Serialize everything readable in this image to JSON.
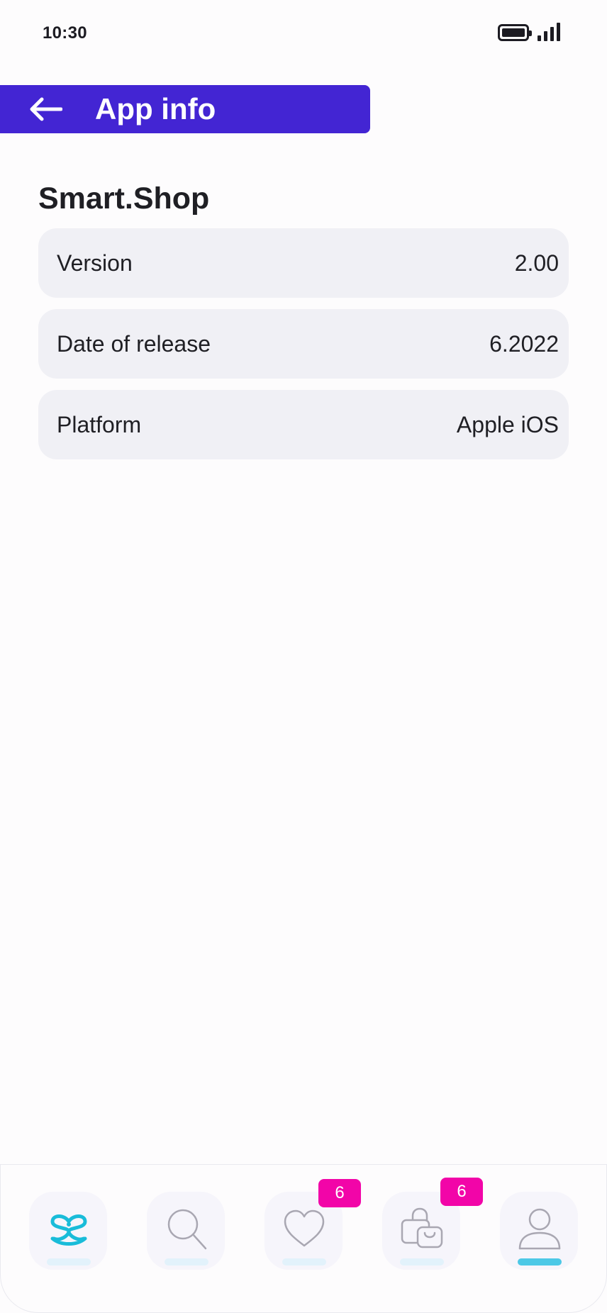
{
  "status_bar": {
    "time": "10:30"
  },
  "header": {
    "title": "App info"
  },
  "app": {
    "name": "Smart.Shop",
    "info": [
      {
        "label": "Version",
        "value": "2.00"
      },
      {
        "label": "Date of release",
        "value": "6.2022"
      },
      {
        "label": "Platform",
        "value": "Apple iOS"
      }
    ]
  },
  "bottom_nav": {
    "items": [
      {
        "icon": "home-logo-icon",
        "active": false
      },
      {
        "icon": "search-icon",
        "active": false
      },
      {
        "icon": "heart-icon",
        "active": false,
        "badge": "6"
      },
      {
        "icon": "shopping-bag-icon",
        "active": false,
        "badge": "6"
      },
      {
        "icon": "profile-icon",
        "active": true
      }
    ]
  },
  "colors": {
    "header_bg": "#4325d3",
    "badge_bg": "#f205a8",
    "accent": "#4cc8e6",
    "row_bg": "#f0f0f5"
  }
}
